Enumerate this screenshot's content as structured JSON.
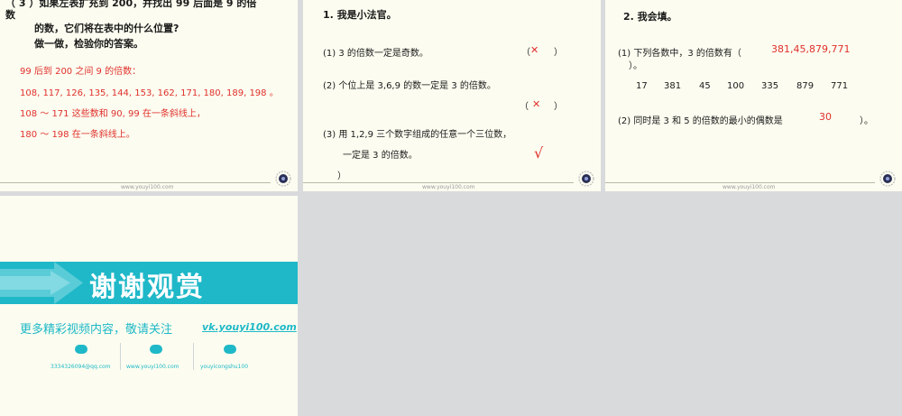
{
  "slide1": {
    "line1": "（ 3 ）如果左表扩充到 200，并找出 99 后面是 9 的倍",
    "line2": "数",
    "line3": "的数，它们将在表中的什么位置?",
    "line4": "做一做，检验你的答案。",
    "answer1": "99 后到 200 之间 9 的倍数：",
    "answer2": "108, 117, 126, 135, 144, 153, 162, 171, 180, 189, 198 。",
    "answer3": "108 ～ 171 这些数和 90, 99 在一条斜线上，",
    "answer4": "180 ～ 198 在一条斜线上。",
    "footer": "www.youyi100.com"
  },
  "slide2": {
    "heading": "1.   我是小法官。",
    "q1": "(1) 3 的倍数一定是奇数。",
    "q1_open": "（",
    "q1_mark": "✕",
    "q1_close": "）",
    "q2": "(2) 个位上是 3,6,9 的数一定是 3 的倍数。",
    "q2_open": "（",
    "q2_mark": "✕",
    "q2_close": "）",
    "q3a": "(3) 用 1,2,9 三个数字组成的任意一个三位数，",
    "q3b": "一定是 3 的倍数。",
    "q3_mark": "√",
    "q3_close": "）",
    "footer": "www.youyi100.com"
  },
  "slide3": {
    "heading": "2.   我会填。",
    "q1_text": "(1)  下列各数中，3 的倍数有（",
    "q1_answer": "381,45,879,771",
    "q1_close": "）。",
    "numbers": [
      "17",
      "381",
      "45",
      "100",
      "335",
      "879",
      "771"
    ],
    "q2_text": "(2)  同时是 3 和 5 的倍数的最小的偶数是",
    "q2_answer": "30",
    "q2_close": "）。",
    "footer": "www.youyi100.com"
  },
  "slide4": {
    "title": "谢谢观赏",
    "subtitle": "更多精彩视频内容，敬请关注",
    "link": "vk.youyi100.com",
    "contacts": [
      "3334326094@qq.com",
      "www.youyi100.com",
      "youyicongshu100"
    ]
  },
  "colors": {
    "accent": "#1fb8c8",
    "answer": "#e0302c"
  }
}
